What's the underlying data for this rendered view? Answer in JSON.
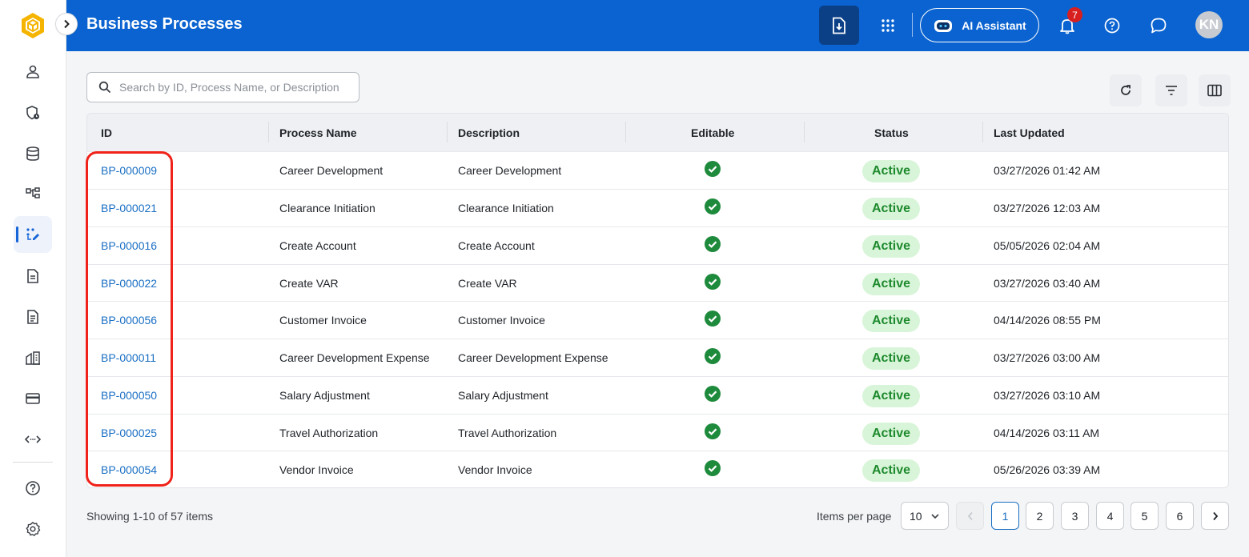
{
  "header": {
    "title": "Business Processes",
    "ai_assistant_label": "AI Assistant",
    "notification_count": "7",
    "avatar_initials": "KN"
  },
  "rail": {
    "items": [
      "user-icon",
      "shield-clock-icon",
      "database-icon",
      "hierarchy-icon",
      "process-edit-icon",
      "document-icon",
      "document-lines-icon",
      "building-icon",
      "credit-card-icon",
      "code-arrows-icon"
    ],
    "active_item": "process-edit-icon",
    "bottom_items": [
      "help-icon",
      "settings-icon"
    ]
  },
  "search": {
    "placeholder": "Search by ID, Process Name, or Description"
  },
  "table": {
    "columns": [
      "ID",
      "Process Name",
      "Description",
      "Editable",
      "Status",
      "Last Updated"
    ],
    "rows": [
      {
        "id": "BP-000009",
        "name": "Career Development",
        "description": "Career Development",
        "editable": true,
        "status": "Active",
        "updated": "03/27/2026 01:42 AM"
      },
      {
        "id": "BP-000021",
        "name": "Clearance Initiation",
        "description": "Clearance Initiation",
        "editable": true,
        "status": "Active",
        "updated": "03/27/2026 12:03 AM"
      },
      {
        "id": "BP-000016",
        "name": "Create Account",
        "description": "Create Account",
        "editable": true,
        "status": "Active",
        "updated": "05/05/2026 02:04 AM"
      },
      {
        "id": "BP-000022",
        "name": "Create VAR",
        "description": "Create VAR",
        "editable": true,
        "status": "Active",
        "updated": "03/27/2026 03:40 AM"
      },
      {
        "id": "BP-000056",
        "name": "Customer Invoice",
        "description": "Customer Invoice",
        "editable": true,
        "status": "Active",
        "updated": "04/14/2026 08:55 PM"
      },
      {
        "id": "BP-000011",
        "name": "Career Development Expense",
        "description": "Career Development Expense",
        "editable": true,
        "status": "Active",
        "updated": "03/27/2026 03:00 AM"
      },
      {
        "id": "BP-000050",
        "name": "Salary Adjustment",
        "description": "Salary Adjustment",
        "editable": true,
        "status": "Active",
        "updated": "03/27/2026 03:10 AM"
      },
      {
        "id": "BP-000025",
        "name": "Travel Authorization",
        "description": "Travel Authorization",
        "editable": true,
        "status": "Active",
        "updated": "04/14/2026 03:11 AM"
      },
      {
        "id": "BP-000054",
        "name": "Vendor Invoice",
        "description": "Vendor Invoice",
        "editable": true,
        "status": "Active",
        "updated": "05/26/2026 03:39 AM"
      }
    ]
  },
  "footer": {
    "showing": "Showing 1-10 of 57 items",
    "items_per_page_label": "Items per page",
    "items_per_page_value": "10",
    "pages": [
      "1",
      "2",
      "3",
      "4",
      "5",
      "6"
    ],
    "current_page": "1"
  },
  "colors": {
    "header_bg": "#0a63d0",
    "link": "#1a6fc4",
    "status_bg": "#d9f5d9",
    "status_text": "#1e8a2e",
    "check": "#1e8a3c",
    "highlight": "#f0221a"
  }
}
